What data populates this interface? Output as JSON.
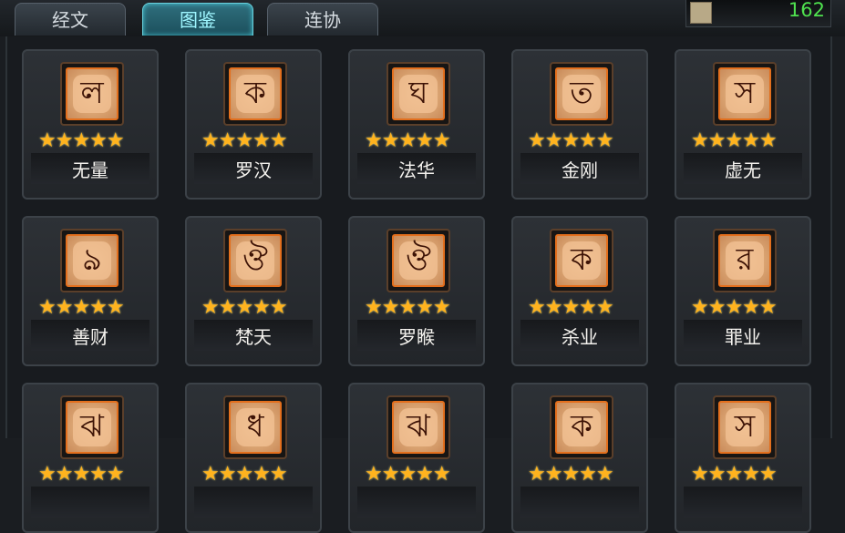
{
  "tabs": [
    "经文",
    "图鉴",
    "连协"
  ],
  "active_tab": 1,
  "currency": {
    "icon": "scroll-icon",
    "value": "162"
  },
  "cards": [
    {
      "name": "无量",
      "stars": 5,
      "glyph": "ল"
    },
    {
      "name": "罗汉",
      "stars": 5,
      "glyph": "ক"
    },
    {
      "name": "法华",
      "stars": 5,
      "glyph": "ঘ"
    },
    {
      "name": "金刚",
      "stars": 5,
      "glyph": "ত"
    },
    {
      "name": "虚无",
      "stars": 5,
      "glyph": "স"
    },
    {
      "name": "善财",
      "stars": 5,
      "glyph": "ঌ"
    },
    {
      "name": "梵天",
      "stars": 5,
      "glyph": "ঔ"
    },
    {
      "name": "罗睺",
      "stars": 5,
      "glyph": "ঔ"
    },
    {
      "name": "杀业",
      "stars": 5,
      "glyph": "ক"
    },
    {
      "name": "罪业",
      "stars": 5,
      "glyph": "র"
    },
    {
      "name": "",
      "stars": 5,
      "glyph": "ঝ"
    },
    {
      "name": "",
      "stars": 5,
      "glyph": "ধ"
    },
    {
      "name": "",
      "stars": 5,
      "glyph": "ঝ"
    },
    {
      "name": "",
      "stars": 5,
      "glyph": "ক"
    },
    {
      "name": "",
      "stars": 5,
      "glyph": "স"
    }
  ]
}
